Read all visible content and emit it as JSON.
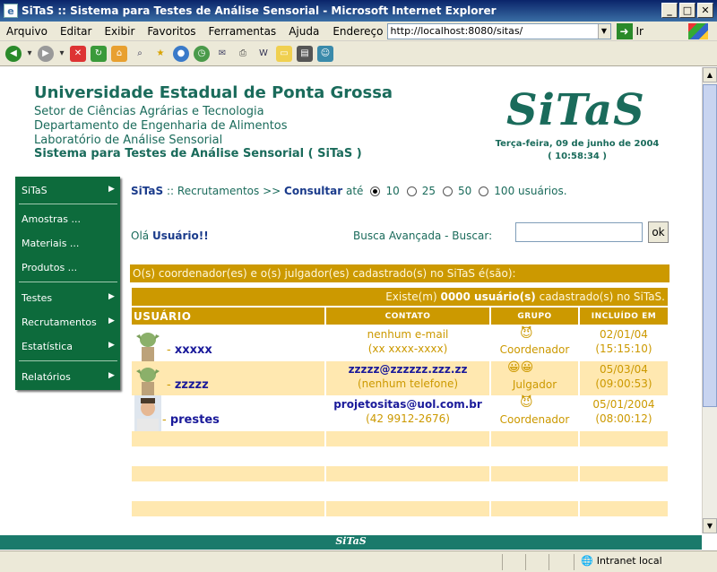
{
  "window": {
    "title": "SiTaS :: Sistema para Testes de Análise Sensorial - Microsoft Internet Explorer"
  },
  "menubar": {
    "items": [
      "Arquivo",
      "Editar",
      "Exibir",
      "Favoritos",
      "Ferramentas",
      "Ajuda"
    ],
    "address_label": "Endereço",
    "address_value": "http://localhost:8080/sitas/",
    "go_label": "Ir"
  },
  "header": {
    "university": "Universidade Estadual de Ponta Grossa",
    "lines": [
      "Setor de Ciências Agrárias e Tecnologia",
      "Departamento de Engenharia de Alimentos",
      "Laboratório de Análise Sensorial"
    ],
    "system": "Sistema para Testes de Análise Sensorial ( SiTaS )",
    "logo": "SiTaS",
    "date": "Terça-feira, 09 de junho de 2004",
    "time": "( 10:58:34 )"
  },
  "sidemenu": {
    "items": [
      "SiTaS",
      "Amostras ...",
      "Materiais ...",
      "Produtos ...",
      "Testes",
      "Recrutamentos",
      "Estatística",
      "Relatórios"
    ]
  },
  "breadcrumb": {
    "root": "SiTaS",
    "sep1": "::",
    "section": "Recrutamentos",
    "sep2": ">>",
    "current": "Consultar",
    "ate": "até",
    "options": [
      "10",
      "25",
      "50",
      "100 usuários."
    ],
    "selected": "10"
  },
  "greeting": {
    "prefix": "Olá",
    "user": "Usuário!!"
  },
  "search": {
    "label": "Busca Avançada - Buscar:",
    "value": "",
    "button": "ok"
  },
  "results": {
    "caption": "O(s) coordenador(es) e o(s) julgador(es) cadastrado(s) no SiTaS é(são):",
    "count_prefix": "Existe(m)",
    "count_value": "0000 usuário(s)",
    "count_suffix": "cadastrado(s) no SiTaS.",
    "columns": [
      "USUÁRIO",
      "CONTATO",
      "GRUPO",
      "INCLUÍDO EM"
    ],
    "rows": [
      {
        "name": "xxxxx",
        "email": "nenhum e-mail",
        "phone": "(xx xxxx-xxxx)",
        "group": "Coordenador",
        "date": "02/01/04",
        "time": "(15:15:10)"
      },
      {
        "name": "zzzzz",
        "email": "zzzzz@zzzzzz.zzz.zz",
        "phone": "(nenhum telefone)",
        "group": "Julgador",
        "date": "05/03/04",
        "time": "(09:00:53)"
      },
      {
        "name": "prestes",
        "email": "projetositas@uol.com.br",
        "phone": "(42 9912-2676)",
        "group": "Coordenador",
        "date": "05/01/2004",
        "time": "(08:00:12)"
      }
    ]
  },
  "footer": {
    "text": "SiTaS"
  },
  "statusbar": {
    "zone": "Intranet local"
  },
  "colors": {
    "brand_green": "#1a6b5b",
    "menu_green": "#0d6b3c",
    "gold": "#cc9900",
    "row_alt": "#ffe8b0"
  }
}
